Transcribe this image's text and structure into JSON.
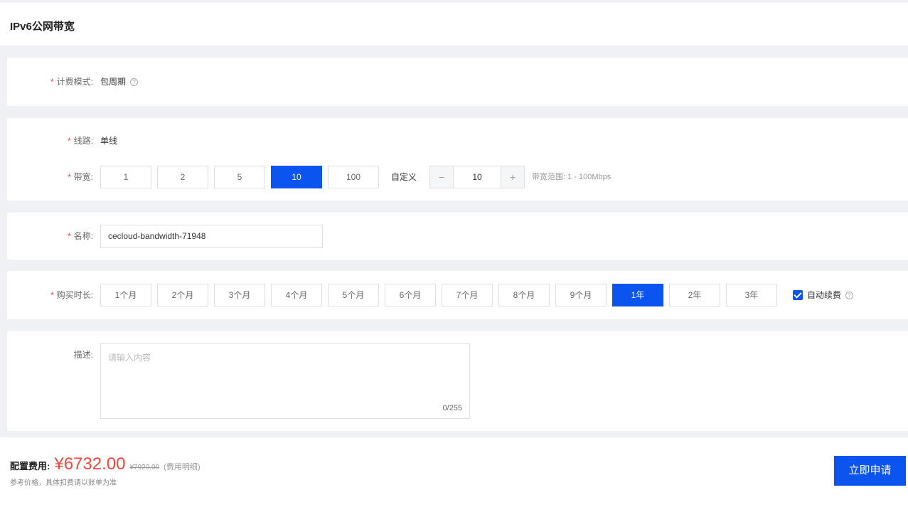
{
  "page": {
    "title": "IPv6公网带宽"
  },
  "billing": {
    "label": "计费模式:",
    "value": "包周期"
  },
  "line": {
    "label": "线路:",
    "value": "单线"
  },
  "bandwidth": {
    "label": "带宽:",
    "options": [
      "1",
      "2",
      "5",
      "10",
      "100"
    ],
    "selected": "10",
    "custom_label": "自定义",
    "minus": "−",
    "plus": "+",
    "custom_value": "10",
    "range_hint": "带宽范围: 1 - 100Mbps"
  },
  "name": {
    "label": "名称:",
    "value": "cecloud-bandwidth-71948"
  },
  "duration": {
    "label": "购买时长:",
    "options": [
      "1个月",
      "2个月",
      "3个月",
      "4个月",
      "5个月",
      "6个月",
      "7个月",
      "8个月",
      "9个月",
      "1年",
      "2年",
      "3年"
    ],
    "selected": "1年",
    "auto_renew_label": "自动续费",
    "auto_renew_checked": true
  },
  "description": {
    "label": "描述:",
    "placeholder": "请输入内容",
    "counter": "0/255"
  },
  "footer": {
    "fee_label": "配置费用:",
    "price": "¥6732.00",
    "original_price": "¥7920.00",
    "detail_link": "(费用明细)",
    "note": "参考价格，具体扣费请以账单为准",
    "submit_label": "立即申请"
  },
  "colors": {
    "accent": "#0b54f0",
    "price": "#f5453d",
    "required": "#f5453d"
  },
  "icons": {
    "help": "question-circle-icon",
    "check": "check-icon"
  }
}
